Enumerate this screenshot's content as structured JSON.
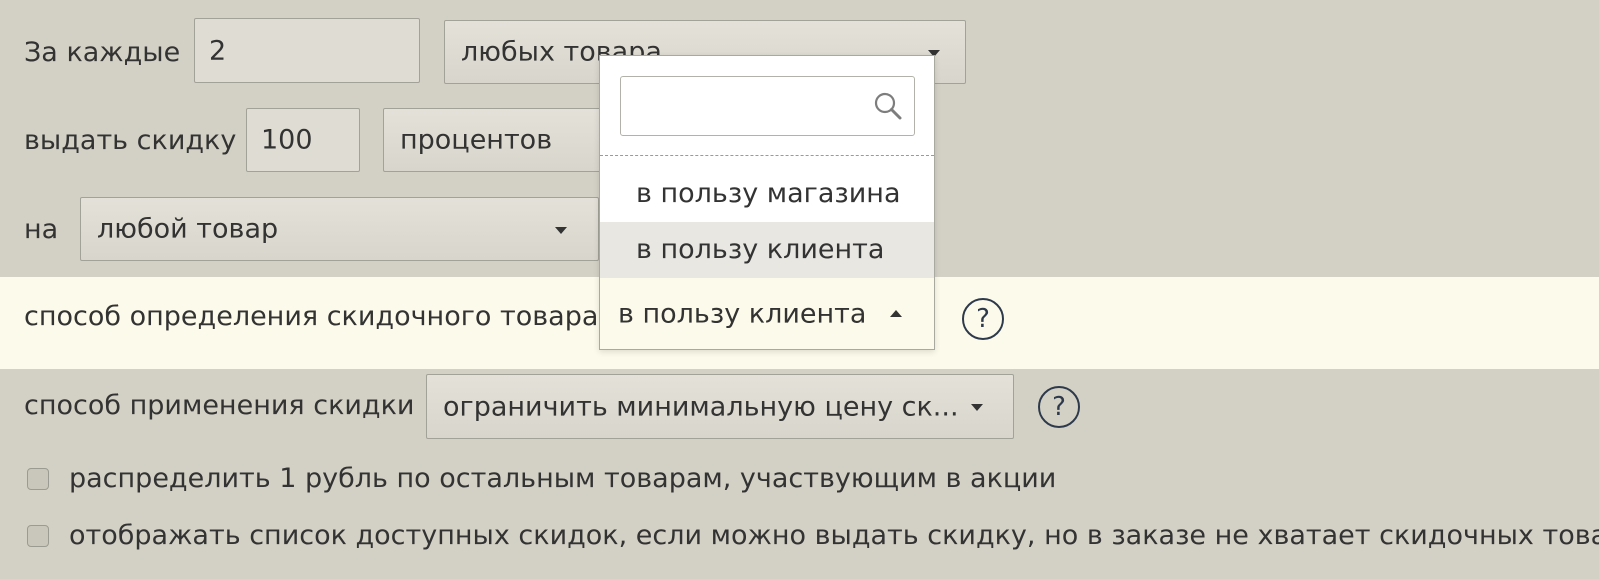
{
  "row_every": {
    "label": "За каждые",
    "quantity": "2",
    "goods_select": "любых товара"
  },
  "row_discount": {
    "label": "выдать скидку",
    "amount": "100",
    "unit_select": "процентов"
  },
  "row_target": {
    "label": "на",
    "target_select": "любой товар"
  },
  "row_method": {
    "label": "способ определения скидочного товара",
    "selected": "в пользу клиента",
    "help": "?"
  },
  "dropdown": {
    "search_placeholder": "",
    "options": [
      {
        "label": "в пользу магазина"
      },
      {
        "label": "в пользу клиента"
      }
    ]
  },
  "row_apply": {
    "label": "способ применения скидки",
    "apply_select": "ограничить минимальную цену ск...",
    "help": "?"
  },
  "checkboxes": [
    {
      "label": "распределить 1 рубль по остальным товарам, участвующим в акции",
      "checked": false
    },
    {
      "label": "отображать список доступных скидок, если можно выдать скидку, но в заказе не хватает скидочных товаров",
      "checked": false
    }
  ],
  "colors": {
    "background": "#d3d1c5",
    "highlight_row": "#fcfaea",
    "help_icon": "#2e3a4b"
  }
}
